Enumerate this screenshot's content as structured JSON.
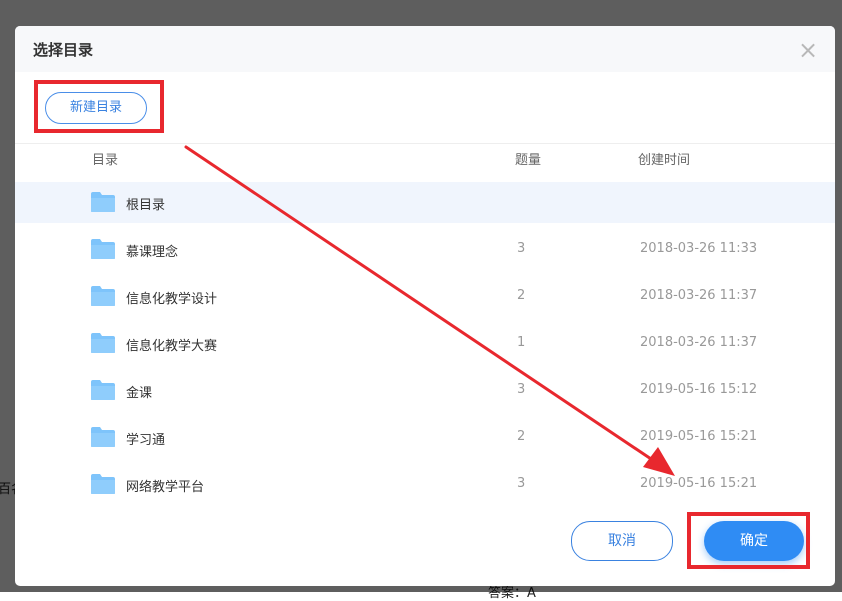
{
  "background": {
    "left_fragment": "百名",
    "bottom_fragment": "答案：A"
  },
  "dialog": {
    "title": "选择目录",
    "close_icon": "close-icon",
    "new_dir_button": "新建目录",
    "columns": {
      "name": "目录",
      "count": "题量",
      "created": "创建时间"
    },
    "rows": [
      {
        "name": "根目录",
        "count": "",
        "created": "",
        "selected": true
      },
      {
        "name": "慕课理念",
        "count": "3",
        "created": "2018-03-26 11:33"
      },
      {
        "name": "信息化教学设计",
        "count": "2",
        "created": "2018-03-26 11:37"
      },
      {
        "name": "信息化教学大赛",
        "count": "1",
        "created": "2018-03-26 11:37"
      },
      {
        "name": "金课",
        "count": "3",
        "created": "2019-05-16 15:12"
      },
      {
        "name": "学习通",
        "count": "2",
        "created": "2019-05-16 15:21"
      },
      {
        "name": "网络教学平台",
        "count": "3",
        "created": "2019-05-16 15:21"
      }
    ],
    "cancel_button": "取消",
    "ok_button": "确定"
  },
  "colors": {
    "accent": "#2f8cf4",
    "folder": "#7ec4fb",
    "annotation": "#e8282e",
    "selected_row": "#f0f5fd"
  }
}
